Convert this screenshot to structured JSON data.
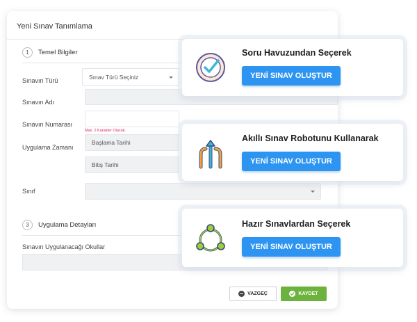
{
  "form": {
    "title": "Yeni Sınav Tanımlama",
    "section1": {
      "number": "1",
      "label": "Temel Bilgiler"
    },
    "labels": {
      "exam_type": "Sınavın Türü",
      "exam_name": "Sınavın Adı",
      "exam_number": "Sınavın Numarası",
      "apply_time": "Uygulama Zamanı",
      "class": "Sınıf",
      "schools": "Sınavın Uygulanacağı Okullar"
    },
    "exam_type_value": "Sınav Türü Seçiniz",
    "hint": "Max. 2 Karakter Olacak.",
    "start_date_placeholder": "Başlama Tarihi",
    "end_date_placeholder": "Bitiş Tarihi",
    "section3": {
      "number": "3",
      "label": "Uygulama Detayları"
    },
    "cancel_label": "VAZGEÇ",
    "save_label": "KAYDET"
  },
  "cards": [
    {
      "title": "Soru Havuzundan Seçerek",
      "button": "YENİ SINAV OLUŞTUR",
      "icon": "checkmark-badge-icon"
    },
    {
      "title": "Akıllı Sınav Robotunu Kullanarak",
      "button": "YENİ SINAV OLUŞTUR",
      "icon": "direction-arrows-icon"
    },
    {
      "title": "Hazır Sınavlardan Seçerek",
      "button": "YENİ SINAV OLUŞTUR",
      "icon": "network-nodes-icon"
    }
  ],
  "colors": {
    "primary": "#2d95f1",
    "success": "#6cb33e",
    "hint": "#e0245e"
  }
}
